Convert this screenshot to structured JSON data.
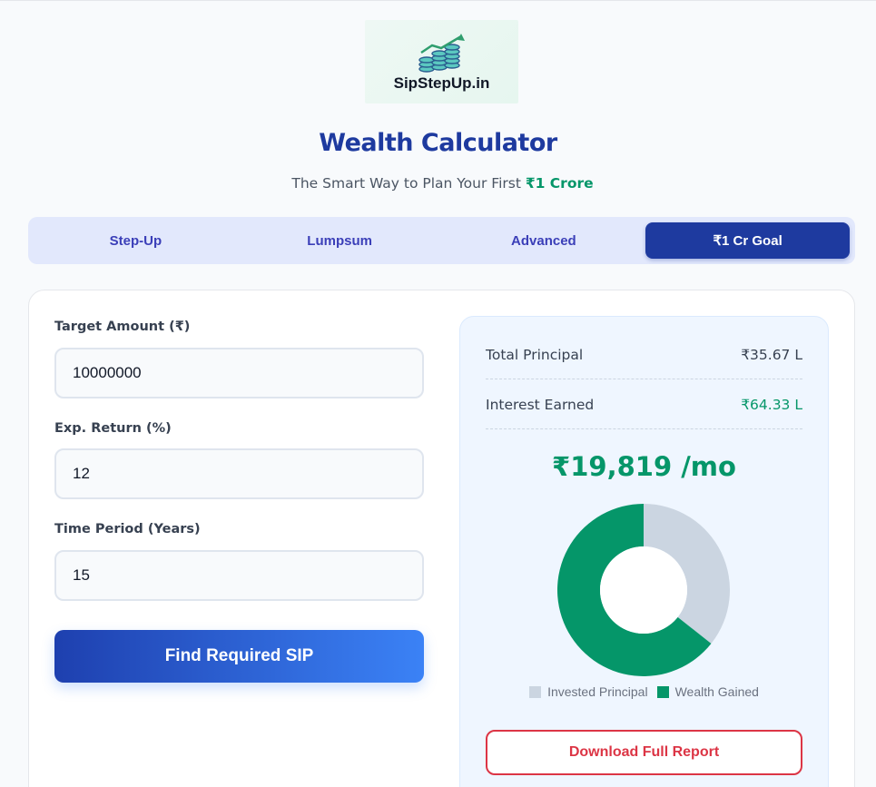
{
  "brand": {
    "logo_text": "SipStepUp.in"
  },
  "header": {
    "title": "Wealth Calculator",
    "subtitle_prefix": "The Smart Way to Plan Your First ",
    "subtitle_highlight": "₹1 Crore"
  },
  "tabs": [
    {
      "label": "Step-Up",
      "active": false
    },
    {
      "label": "Lumpsum",
      "active": false
    },
    {
      "label": "Advanced",
      "active": false
    },
    {
      "label": "₹1 Cr Goal",
      "active": true
    }
  ],
  "form": {
    "target": {
      "label": "Target Amount (₹)",
      "value": "10000000"
    },
    "return": {
      "label": "Exp. Return (%)",
      "value": "12"
    },
    "period": {
      "label": "Time Period (Years)",
      "value": "15"
    },
    "submit_label": "Find Required SIP"
  },
  "results": {
    "principal_label": "Total Principal",
    "principal_value": "₹35.67 L",
    "interest_label": "Interest Earned",
    "interest_value": "₹64.33 L",
    "sip_amount": "₹19,819 /mo",
    "download_label": "Download Full Report"
  },
  "chart_data": {
    "type": "pie",
    "categories": [
      "Invested Principal",
      "Wealth Gained"
    ],
    "values": [
      35.67,
      64.33
    ],
    "colors": [
      "#cbd5e1",
      "#059669"
    ]
  },
  "colors": {
    "primary": "#1e3a9f",
    "accent_green": "#059669",
    "danger": "#dc3545"
  }
}
